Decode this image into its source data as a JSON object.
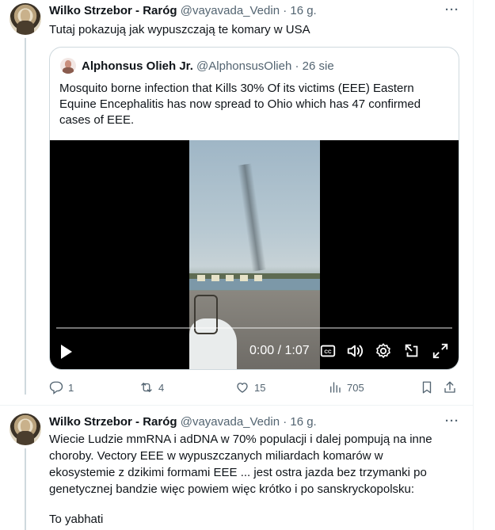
{
  "tweets": [
    {
      "author_name": "Wilko Strzebor - Raróg",
      "handle_time": "@vayavada_Vedin · 16 g.",
      "text": "Tutaj pokazują jak wypuszczają te komary w USA",
      "quote": {
        "author_name": "Alphonsus Olieh Jr.",
        "handle_time": "@AlphonsusOlieh · 26 sie",
        "text": "Mosquito borne infection that Kills 30% Of its victims (EEE) Eastern Equine Encephalitis has now spread to Ohio which has 47 confirmed cases of EEE.",
        "video": {
          "time": "0:00 / 1:07",
          "progress": 0
        }
      },
      "actions": {
        "replies": "1",
        "reposts": "4",
        "likes": "15",
        "views": "705"
      }
    },
    {
      "author_name": "Wilko Strzebor - Raróg",
      "handle_time": "@vayavada_Vedin · 16 g.",
      "lines": [
        "Wiecie Ludzie mmRNA i adDNA w 70% populacji i dalej pompują na inne",
        "choroby. Vectory EEE w wypuszczanych miliardach komarów w",
        "ekosystemie z dzikimi formami EEE ... jest ostra jazda bez trzymanki po",
        "genetycznej bandzie więc powiem więc krótko i po sanskryckopolsku:",
        "",
        "To yabhati"
      ]
    }
  ],
  "icons": {
    "more": "more-icon",
    "reply": "reply-icon",
    "repost": "repost-icon",
    "like": "like-icon",
    "views": "views-icon",
    "bookmark": "bookmark-icon",
    "share": "share-icon"
  },
  "colors": {
    "text": "#0f1419",
    "muted": "#536471",
    "border": "#cfd9de"
  },
  "more_label": "···"
}
